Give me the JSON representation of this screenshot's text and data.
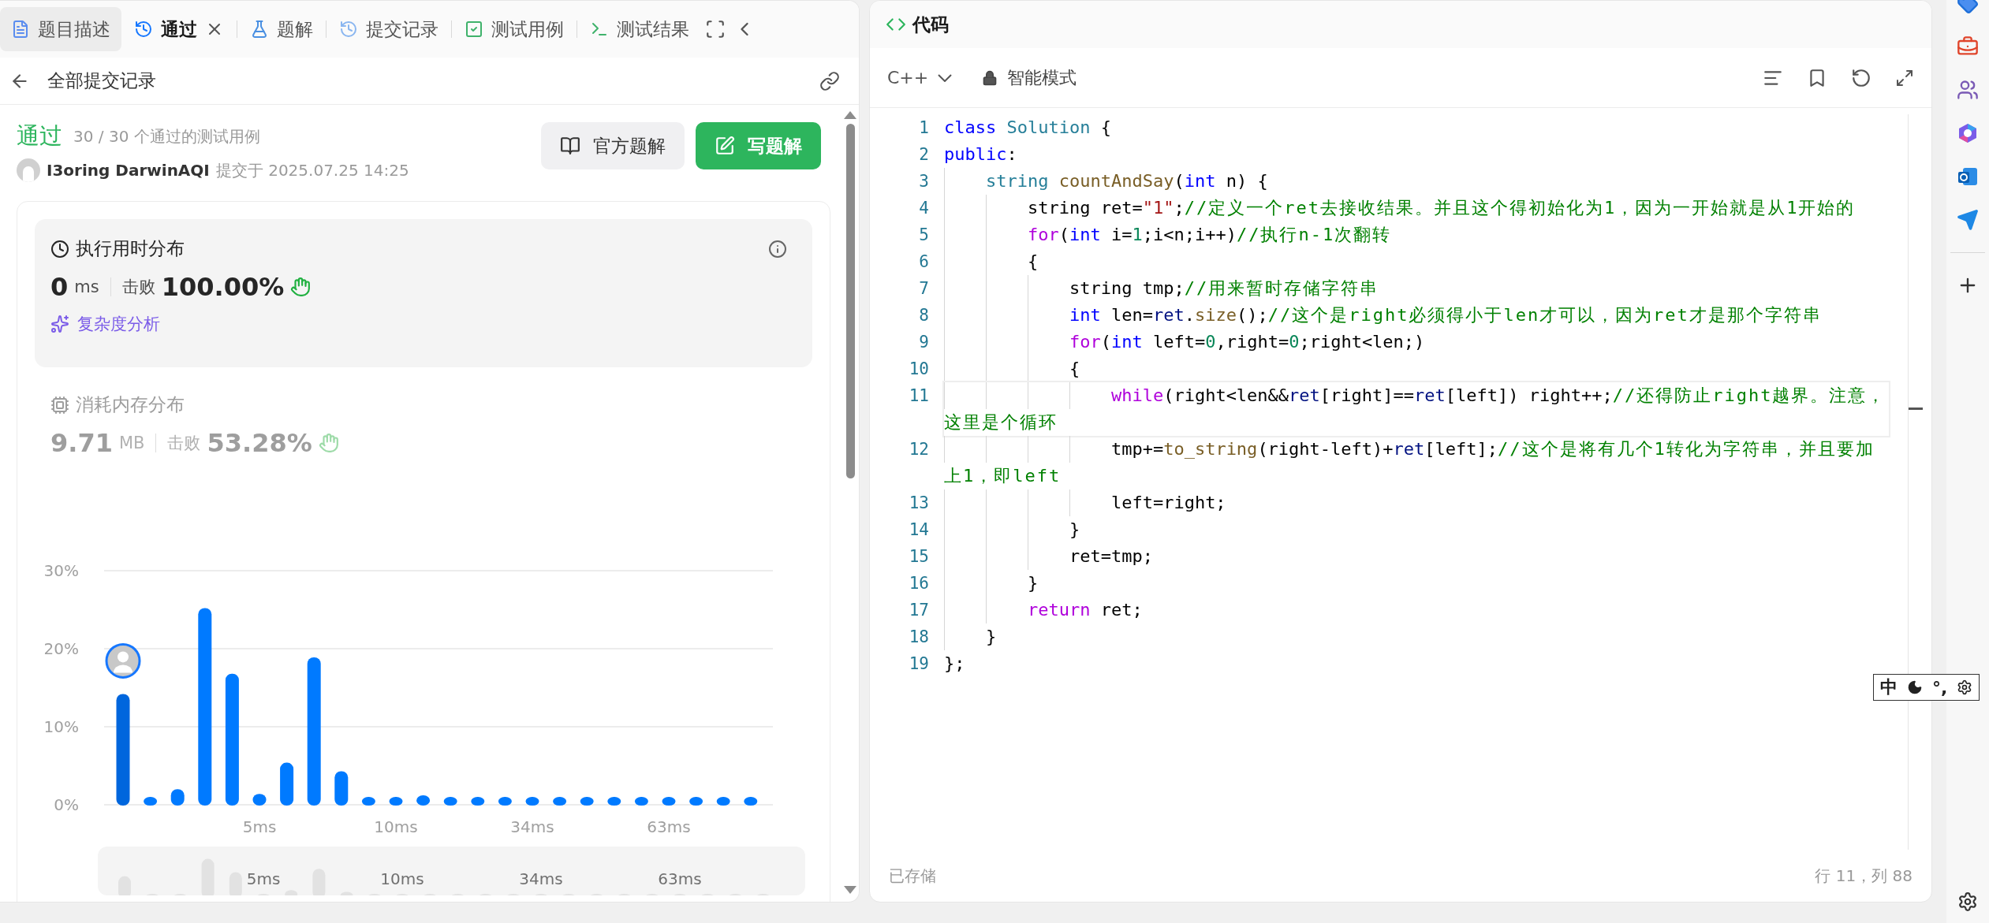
{
  "tabs": [
    {
      "label": "题目描述",
      "kind": "description",
      "selected": false,
      "highlighted": true,
      "closable": false
    },
    {
      "label": "通过",
      "kind": "submission",
      "selected": true,
      "highlighted": false,
      "closable": true
    },
    {
      "label": "题解",
      "kind": "solution",
      "selected": false,
      "highlighted": false,
      "closable": false
    },
    {
      "label": "提交记录",
      "kind": "record",
      "selected": false,
      "highlighted": false,
      "closable": false
    },
    {
      "label": "测试用例",
      "kind": "testcase",
      "selected": false,
      "highlighted": false,
      "closable": false
    },
    {
      "label": "测试结果",
      "kind": "result",
      "selected": false,
      "highlighted": false,
      "closable": false
    }
  ],
  "back_link": "全部提交记录",
  "submission": {
    "status": "通过",
    "summary": "30 / 30 个通过的测试用例",
    "author": "I3oring DarwinAQI",
    "submitted": "提交于 2025.07.25 14:25"
  },
  "buttons": [
    {
      "label": "官方题解",
      "kind": "secondary"
    },
    {
      "label": "写题解",
      "kind": "primary"
    }
  ],
  "runtime": {
    "title": "执行用时分布",
    "value": "0",
    "unit": "ms",
    "beats_label": "击败",
    "beats": "100.00%",
    "analysis": "复杂度分析",
    "selected": true
  },
  "memory": {
    "title": "消耗内存分布",
    "value": "9.71",
    "unit": "MB",
    "beats_label": "击败",
    "beats": "53.28%",
    "selected": false
  },
  "chart_data": {
    "type": "bar",
    "categories": [
      null,
      null,
      null,
      null,
      null,
      "5ms",
      null,
      null,
      null,
      null,
      "10ms",
      null,
      null,
      null,
      null,
      "34ms",
      null,
      null,
      null,
      null,
      "63ms",
      null,
      null,
      null
    ],
    "series": [
      {
        "color": "#0066dd",
        "values": [
          14.2,
          null,
          null,
          null,
          null,
          null,
          null,
          null,
          null,
          null,
          null,
          null,
          null,
          null,
          null,
          null,
          null,
          null,
          null,
          null,
          null,
          null,
          null,
          null
        ]
      },
      {
        "color": "#007aff",
        "values": [
          null,
          1.0,
          2.0,
          25.2,
          16.8,
          1.4,
          5.4,
          18.9,
          4.3,
          1.0,
          1.0,
          1.2,
          1.0,
          1.0,
          1.0,
          1.0,
          1.0,
          1.0,
          1.0,
          1.0,
          1.0,
          1.0,
          1.0,
          1.0
        ]
      }
    ],
    "ylim": [
      0,
      30
    ],
    "yticks": [
      {
        "value": 0,
        "label": "0%"
      },
      {
        "value": 10,
        "label": "10%"
      },
      {
        "value": 20,
        "label": "20%"
      },
      {
        "value": 30,
        "label": "30%"
      }
    ]
  },
  "mini_chart": {
    "labels": [
      "5ms",
      "10ms",
      "34ms",
      "63ms"
    ]
  },
  "code": {
    "title": "代码",
    "language": "C++",
    "mode": "智能模式",
    "status": "已存储",
    "cursor": "行 11，列 88",
    "lines": [
      {
        "number": "1",
        "current": false,
        "tokens": [
          {
            "kind": "keyword",
            "text": "class"
          },
          {
            "kind": "type",
            "text": " Solution"
          },
          {
            "kind": "plain",
            "text": " {"
          }
        ]
      },
      {
        "number": "2",
        "current": false,
        "tokens": [
          {
            "kind": "keyword",
            "text": "public"
          },
          {
            "kind": "plain",
            "text": ":"
          }
        ]
      },
      {
        "number": "3",
        "current": false,
        "tokens": [
          {
            "kind": "type",
            "text": "    string"
          },
          {
            "kind": "function",
            "text": " countAndSay"
          },
          {
            "kind": "plain",
            "text": "("
          },
          {
            "kind": "keyword",
            "text": "int"
          },
          {
            "kind": "plain",
            "text": " n) {"
          }
        ]
      },
      {
        "number": "4",
        "current": false,
        "tokens": [
          {
            "kind": "plain",
            "text": "        string ret="
          },
          {
            "kind": "string",
            "text": "\"1\""
          },
          {
            "kind": "plain",
            "text": ";"
          },
          {
            "kind": "comment",
            "text": "//定义一个ret去接收结果。并且这个得初始化为1，因为一开始就是从1开始的"
          }
        ]
      },
      {
        "number": "5",
        "current": false,
        "tokens": [
          {
            "kind": "control",
            "text": "        for"
          },
          {
            "kind": "plain",
            "text": "("
          },
          {
            "kind": "keyword",
            "text": "int"
          },
          {
            "kind": "plain",
            "text": " i="
          },
          {
            "kind": "number",
            "text": "1"
          },
          {
            "kind": "plain",
            "text": ";i<n;i++)"
          },
          {
            "kind": "comment",
            "text": "//执行n-1次翻转"
          }
        ]
      },
      {
        "number": "6",
        "current": false,
        "tokens": [
          {
            "kind": "plain",
            "text": "        {"
          }
        ]
      },
      {
        "number": "7",
        "current": false,
        "tokens": [
          {
            "kind": "plain",
            "text": "            string tmp;"
          },
          {
            "kind": "comment",
            "text": "//用来暂时存储字符串"
          }
        ]
      },
      {
        "number": "8",
        "current": false,
        "tokens": [
          {
            "kind": "keyword",
            "text": "            int"
          },
          {
            "kind": "plain",
            "text": " len="
          },
          {
            "kind": "variable",
            "text": "ret"
          },
          {
            "kind": "plain",
            "text": "."
          },
          {
            "kind": "function",
            "text": "size"
          },
          {
            "kind": "plain",
            "text": "();"
          },
          {
            "kind": "comment",
            "text": "//这个是right必须得小于len才可以，因为ret才是那个字符串"
          }
        ]
      },
      {
        "number": "9",
        "current": false,
        "tokens": [
          {
            "kind": "control",
            "text": "            for"
          },
          {
            "kind": "plain",
            "text": "("
          },
          {
            "kind": "keyword",
            "text": "int"
          },
          {
            "kind": "plain",
            "text": " left="
          },
          {
            "kind": "number",
            "text": "0"
          },
          {
            "kind": "plain",
            "text": ",right="
          },
          {
            "kind": "number",
            "text": "0"
          },
          {
            "kind": "plain",
            "text": ";right<len;)"
          }
        ]
      },
      {
        "number": "10",
        "current": false,
        "tokens": [
          {
            "kind": "plain",
            "text": "            {"
          }
        ]
      },
      {
        "number": "11",
        "current": true,
        "tokens": [
          {
            "kind": "control",
            "text": "                while"
          },
          {
            "kind": "plain",
            "text": "(right<len&&"
          },
          {
            "kind": "variable",
            "text": "ret"
          },
          {
            "kind": "plain",
            "text": "[right]=="
          },
          {
            "kind": "variable",
            "text": "ret"
          },
          {
            "kind": "plain",
            "text": "[left]) right++;"
          },
          {
            "kind": "comment",
            "text": "//还得防止right越界。注意，这里是个循环"
          }
        ]
      },
      {
        "number": "12",
        "current": false,
        "tokens": [
          {
            "kind": "plain",
            "text": "                tmp+="
          },
          {
            "kind": "function",
            "text": "to_string"
          },
          {
            "kind": "plain",
            "text": "(right-left)+"
          },
          {
            "kind": "variable",
            "text": "ret"
          },
          {
            "kind": "plain",
            "text": "[left];"
          },
          {
            "kind": "comment",
            "text": "//这个是将有几个1转化为字符串，并且要加上1，即left"
          }
        ]
      },
      {
        "number": "13",
        "current": false,
        "tokens": [
          {
            "kind": "plain",
            "text": "                left=right;"
          }
        ]
      },
      {
        "number": "14",
        "current": false,
        "tokens": [
          {
            "kind": "plain",
            "text": "            }"
          }
        ]
      },
      {
        "number": "15",
        "current": false,
        "tokens": [
          {
            "kind": "plain",
            "text": "            ret=tmp;"
          }
        ]
      },
      {
        "number": "16",
        "current": false,
        "tokens": [
          {
            "kind": "plain",
            "text": "        }"
          }
        ]
      },
      {
        "number": "17",
        "current": false,
        "tokens": [
          {
            "kind": "control",
            "text": "        return"
          },
          {
            "kind": "plain",
            "text": " ret;"
          }
        ]
      },
      {
        "number": "18",
        "current": false,
        "tokens": [
          {
            "kind": "plain",
            "text": "    }"
          }
        ]
      },
      {
        "number": "19",
        "current": false,
        "tokens": [
          {
            "kind": "plain",
            "text": "};"
          }
        ]
      }
    ]
  },
  "ime": {
    "labels": [
      "中",
      "°,"
    ]
  }
}
